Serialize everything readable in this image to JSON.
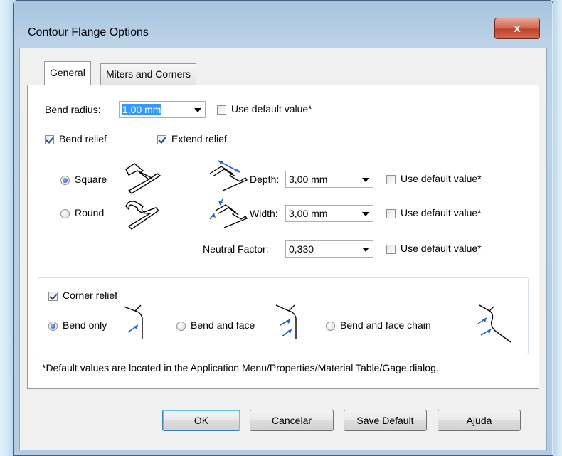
{
  "dialog": {
    "title": "Contour Flange Options",
    "close_label": "x"
  },
  "tabs": [
    {
      "label": "General",
      "active": true
    },
    {
      "label": "Miters and Corners",
      "active": false
    }
  ],
  "bend_radius": {
    "label": "Bend radius:",
    "value": "1,00 mm",
    "use_default_label": "Use default value*",
    "use_default_checked": false
  },
  "bend_relief": {
    "label": "Bend relief",
    "checked": true
  },
  "extend_relief": {
    "label": "Extend relief",
    "checked": true
  },
  "relief_shape": {
    "square_label": "Square",
    "round_label": "Round",
    "selected": "Square"
  },
  "depth": {
    "label": "Depth:",
    "value": "3,00 mm",
    "use_default_label": "Use default value*",
    "use_default_checked": false
  },
  "width": {
    "label": "Width:",
    "value": "3,00 mm",
    "use_default_label": "Use default value*",
    "use_default_checked": false
  },
  "neutral_factor": {
    "label": "Neutral Factor:",
    "value": "0,330",
    "use_default_label": "Use default value*",
    "use_default_checked": false
  },
  "corner_relief": {
    "label": "Corner relief",
    "checked": true,
    "options": [
      "Bend only",
      "Bend and face",
      "Bend and face chain"
    ],
    "selected": "Bend only"
  },
  "note": "*Default values are located in the Application Menu/Properties/Material Table/Gage dialog.",
  "buttons": {
    "ok": "OK",
    "cancel": "Cancelar",
    "save_default": "Save Default",
    "help": "Ajuda"
  },
  "colors": {
    "title_bar": "#b8cfe5",
    "close_button": "#c8503a",
    "selection": "#3399ff",
    "icon_accent": "#1f5fd6"
  }
}
